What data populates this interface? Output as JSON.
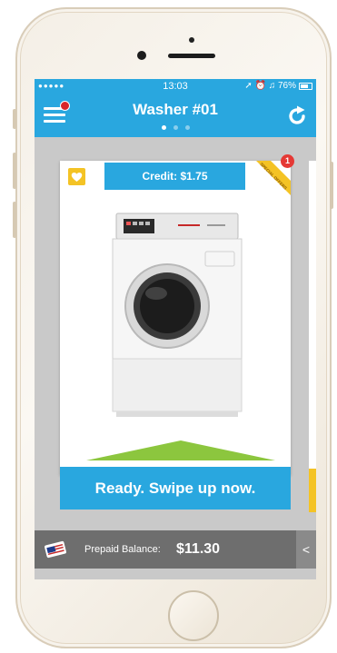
{
  "status_bar": {
    "signal": "●●●●●",
    "time": "13:03",
    "indicators": "➚ ⏰ ♫ 76%",
    "battery_level": 0.76
  },
  "header": {
    "title": "Washer #01",
    "page_count": 3,
    "active_page": 0,
    "menu_icon": "hamburger-menu-icon",
    "refresh_icon": "refresh-icon"
  },
  "card": {
    "credit": "Credit: $1.75",
    "offer_count": "1",
    "offer_ribbon_text": "SPECIAL OFFERS",
    "favorite_icon": "heart-icon",
    "machine_image": "front-load-washer-image",
    "cta": "Ready. Swipe up now."
  },
  "balance": {
    "label": "Prepaid Balance:",
    "value": "$11.30",
    "toggle": "<"
  },
  "colors": {
    "accent_blue": "#29a7df",
    "favorite_yellow": "#f4c325",
    "badge_red": "#d8262a",
    "balance_bar": "#6e6e6e"
  }
}
